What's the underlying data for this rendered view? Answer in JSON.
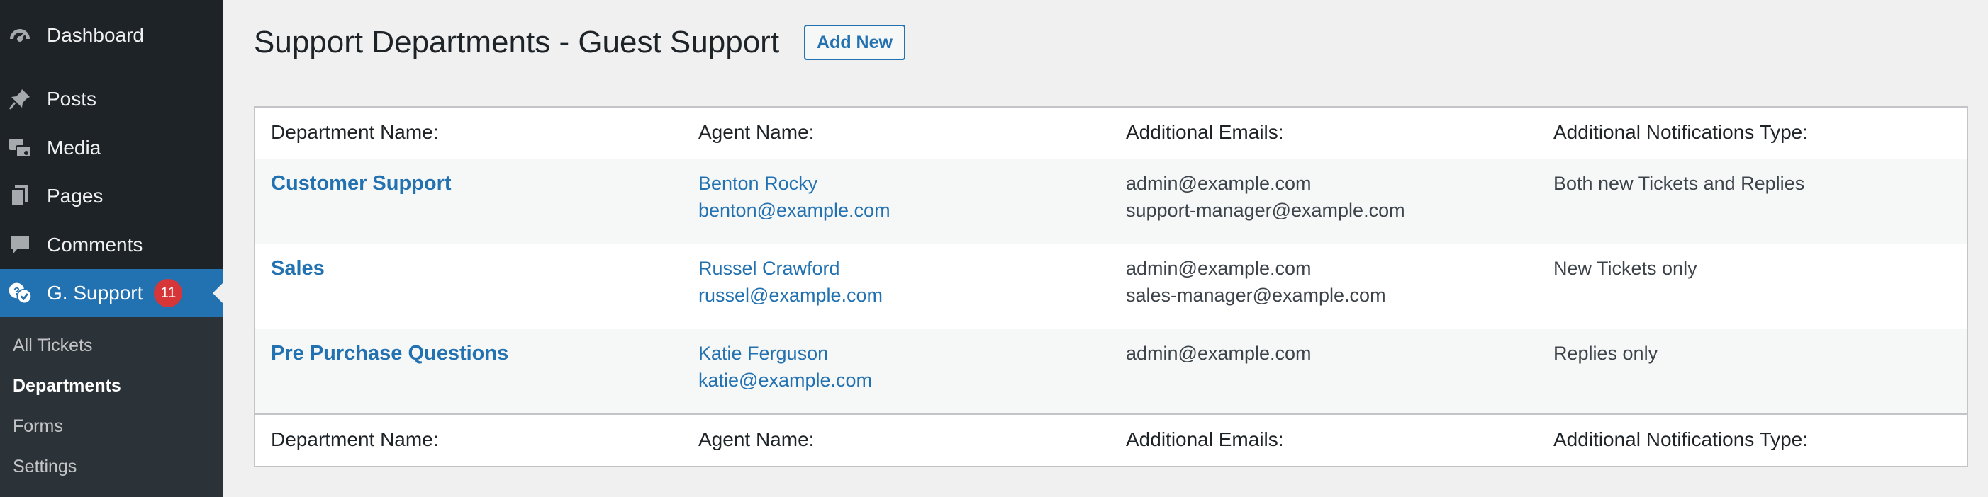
{
  "sidebar": {
    "menu": [
      {
        "label": "Dashboard",
        "icon": "dashboard-icon"
      },
      {
        "label": "Posts",
        "icon": "pin-icon"
      },
      {
        "label": "Media",
        "icon": "media-icon"
      },
      {
        "label": "Pages",
        "icon": "pages-icon"
      },
      {
        "label": "Comments",
        "icon": "comment-icon"
      },
      {
        "label": "G. Support",
        "icon": "support-icon",
        "badge": "11",
        "active": true
      }
    ],
    "submenu": [
      "All Tickets",
      "Departments",
      "Forms",
      "Settings"
    ],
    "current_submenu": "Departments"
  },
  "page": {
    "title": "Support Departments - Guest Support",
    "add_new_label": "Add New"
  },
  "table": {
    "columns": [
      "Department Name:",
      "Agent Name:",
      "Additional Emails:",
      "Additional Notifications Type:"
    ],
    "rows": [
      {
        "department": "Customer Support",
        "agent_name": "Benton Rocky",
        "agent_email": "benton@example.com",
        "emails": [
          "admin@example.com",
          "support-manager@example.com"
        ],
        "notify": "Both new Tickets and Replies"
      },
      {
        "department": "Sales",
        "agent_name": "Russel Crawford",
        "agent_email": "russel@example.com",
        "emails": [
          "admin@example.com",
          "sales-manager@example.com"
        ],
        "notify": "New Tickets only"
      },
      {
        "department": "Pre Purchase Questions",
        "agent_name": "Katie Ferguson",
        "agent_email": "katie@example.com",
        "emails": [
          "admin@example.com"
        ],
        "notify": "Replies only"
      }
    ]
  },
  "colors": {
    "sidebar": "#1d2327",
    "accent": "#2271b1",
    "badge": "#d63638"
  }
}
